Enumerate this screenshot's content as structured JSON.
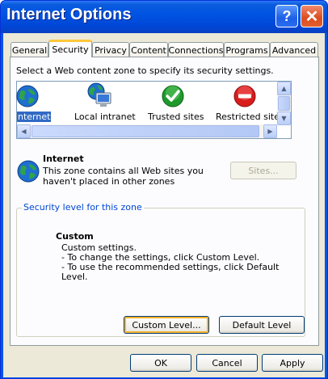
{
  "window": {
    "title": "Internet Options",
    "help_label": "?",
    "close_label": "✕"
  },
  "tabs": [
    {
      "label": "General",
      "active": false
    },
    {
      "label": "Security",
      "active": true
    },
    {
      "label": "Privacy",
      "active": false
    },
    {
      "label": "Content",
      "active": false
    },
    {
      "label": "Connections",
      "active": false
    },
    {
      "label": "Programs",
      "active": false
    },
    {
      "label": "Advanced",
      "active": false
    }
  ],
  "security": {
    "instruction": "Select a Web content zone to specify its security settings.",
    "zones": [
      {
        "label": "nternet",
        "icon": "globe-icon",
        "selected": true
      },
      {
        "label": "Local intranet",
        "icon": "computer-globe-icon",
        "selected": false
      },
      {
        "label": "Trusted sites",
        "icon": "green-check-icon",
        "selected": false
      },
      {
        "label": "Restricted sites",
        "icon": "red-restricted-icon",
        "selected": false
      }
    ],
    "zone_info": {
      "title": "Internet",
      "description": "This zone contains all Web sites you haven't placed in other zones"
    },
    "sites_button": "Sites...",
    "group_label": "Security level for this zone",
    "level_name": "Custom",
    "level_lines": [
      "Custom settings.",
      "- To change the settings, click Custom Level.",
      "- To use the recommended settings, click Default Level."
    ],
    "custom_level_button": "Custom Level...",
    "default_level_button": "Default Level"
  },
  "footer": {
    "ok": "OK",
    "cancel": "Cancel",
    "apply": "Apply"
  },
  "colors": {
    "title_bar": "#0054e3",
    "dialog_bg": "#ece9d8",
    "selection": "#316ac5",
    "tab_highlight": "#ffc83c"
  }
}
